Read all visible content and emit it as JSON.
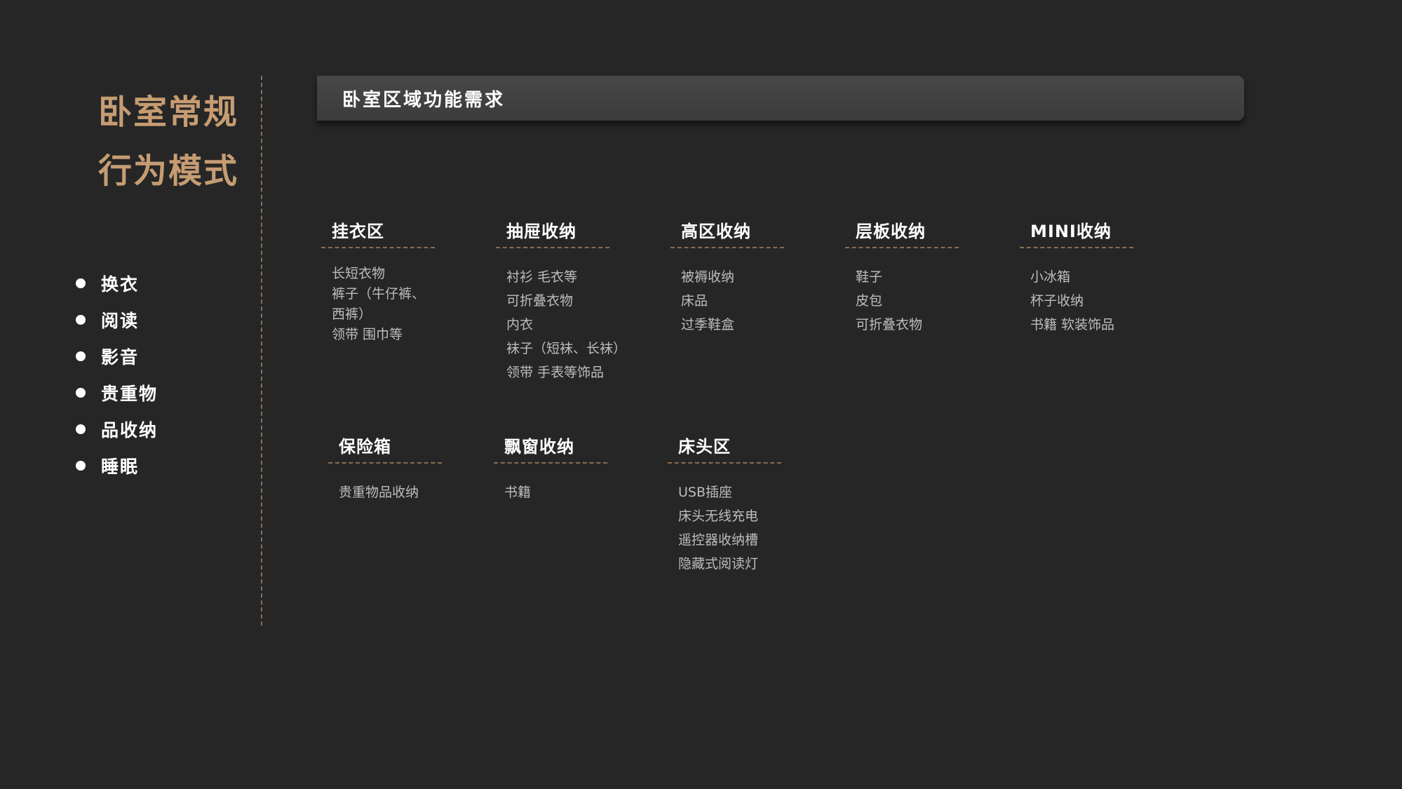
{
  "sidebar": {
    "title_line1": "卧室常规",
    "title_line2": "行为模式",
    "items": [
      "换衣",
      "阅读",
      "影音",
      "贵重物",
      "品收纳",
      "睡眠"
    ]
  },
  "header": {
    "title": "卧室区域功能需求"
  },
  "cards": [
    {
      "title": "挂衣区",
      "items": [
        "长短衣物",
        "裤子（牛仔裤、",
        "西裤）",
        "领带 围巾等"
      ]
    },
    {
      "title": "抽屉收纳",
      "items": [
        "衬衫 毛衣等",
        "可折叠衣物",
        "内衣",
        "袜子（短袜、长袜）",
        "领带 手表等饰品"
      ]
    },
    {
      "title": "高区收纳",
      "items": [
        "被褥收纳",
        "床品",
        "过季鞋盒"
      ]
    },
    {
      "title": "层板收纳",
      "items": [
        "鞋子",
        "皮包",
        "可折叠衣物"
      ]
    },
    {
      "title": "MINI收纳",
      "items": [
        "小冰箱",
        "杯子收纳",
        "书籍 软装饰品"
      ]
    },
    {
      "title": "保险箱",
      "items": [
        "贵重物品收纳"
      ]
    },
    {
      "title": "飘窗收纳",
      "items": [
        "书籍"
      ]
    },
    {
      "title": "床头区",
      "items": [
        "USB插座",
        "床头无线充电",
        "遥控器收纳槽",
        "隐藏式阅读灯"
      ]
    }
  ],
  "colors": {
    "background": "#262626",
    "accent": "#c69c72",
    "header_bar": "#444444",
    "text_primary": "#ffffff",
    "text_secondary": "#bdbdbd"
  }
}
